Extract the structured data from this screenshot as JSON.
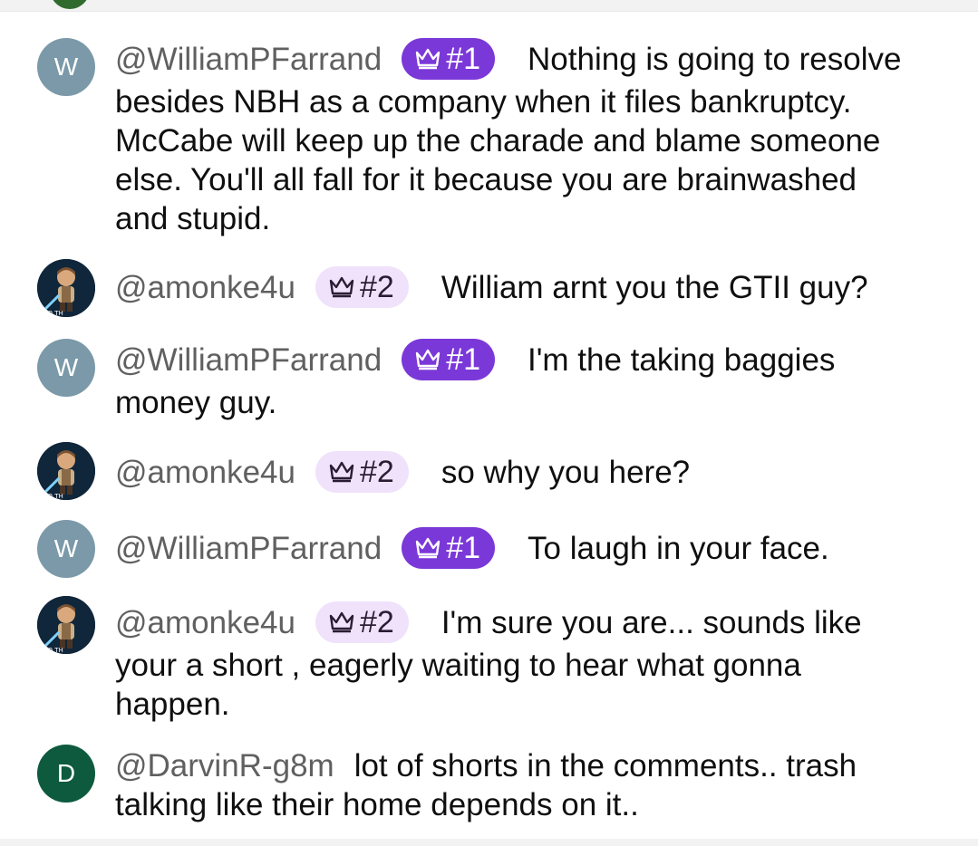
{
  "comments": [
    {
      "handle": "@WilliamPFarrand",
      "avatar_letter": "W",
      "badge": "#1",
      "text": "Nothing is going to resolve besides NBH as a company when it files bankruptcy. McCabe will keep up the charade and blame someone else. You'll all fall for it because you are brainwashed and stupid."
    },
    {
      "handle": "@amonke4u",
      "badge": "#2",
      "text": "William arnt you the GTII guy?"
    },
    {
      "handle": "@WilliamPFarrand",
      "avatar_letter": "W",
      "badge": "#1",
      "text": "I'm the taking baggies money guy."
    },
    {
      "handle": "@amonke4u",
      "badge": "#2",
      "text": "so why you here?"
    },
    {
      "handle": "@WilliamPFarrand",
      "avatar_letter": "W",
      "badge": "#1",
      "text": "To laugh in your face."
    },
    {
      "handle": "@amonke4u",
      "badge": "#2",
      "text": "I'm sure you are... sounds like your a short , eagerly waiting to hear what gonna happen."
    },
    {
      "handle": "@DarvinR-g8m",
      "avatar_letter": "D",
      "text": "lot of shorts in the comments.. trash talking like their home depends on it.."
    }
  ],
  "colors": {
    "badge_rank1_bg": "#7b38d8",
    "badge_rank2_bg": "#f0e2fb",
    "avatar_w": "#7b99a8",
    "avatar_d": "#0d5a3e",
    "handle_text": "#606060"
  },
  "icons": {
    "badge": "crown-icon"
  }
}
